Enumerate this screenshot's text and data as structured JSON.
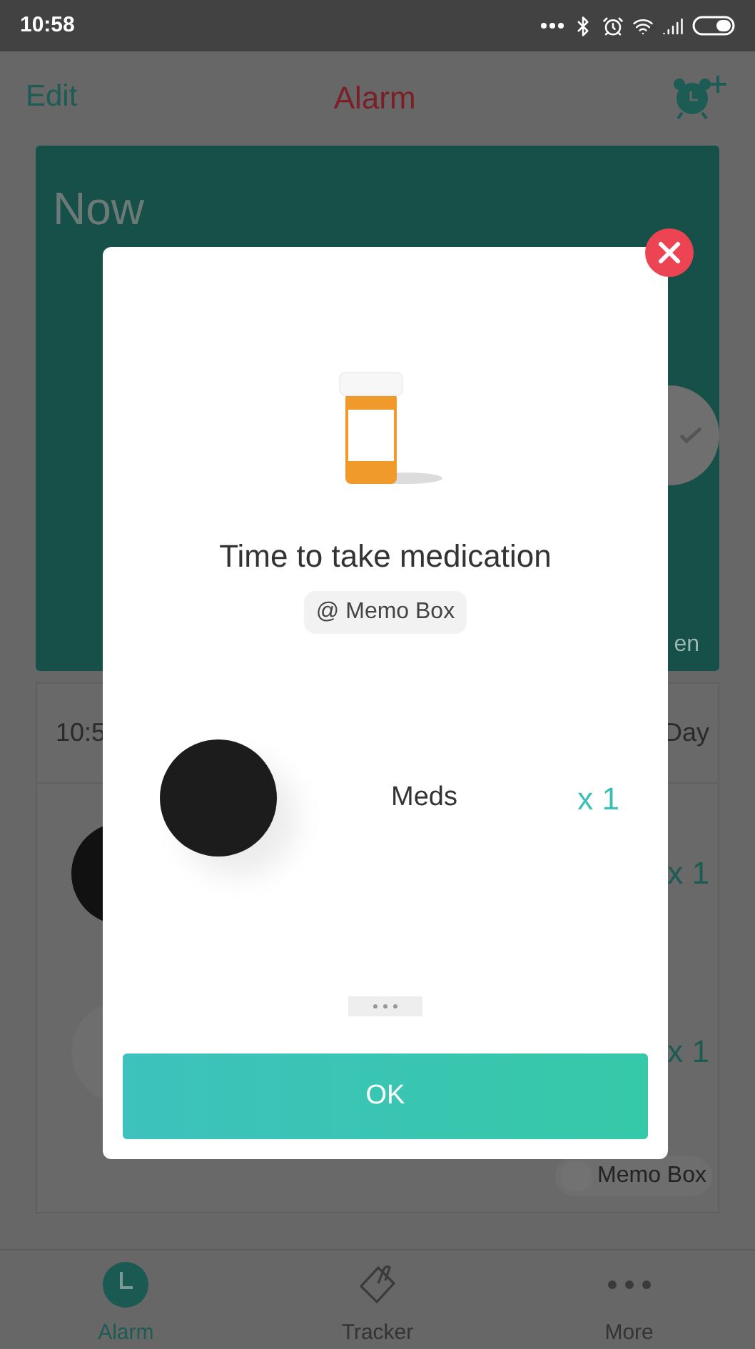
{
  "status_bar": {
    "time": "10:58"
  },
  "header": {
    "edit": "Edit",
    "title": "Alarm"
  },
  "now_card": {
    "title": "Now",
    "caption": "en"
  },
  "schedule_card": {
    "time": "10:5",
    "repeat": "Day",
    "doses": [
      "x 1",
      "x 1"
    ],
    "device": "Memo Box"
  },
  "dialog": {
    "title": "Time to take medication",
    "location": "@ Memo Box",
    "items": [
      {
        "name": "Meds",
        "quantity": "x 1"
      }
    ],
    "ok": "OK"
  },
  "tabs": [
    {
      "label": "Alarm",
      "kind": "clock",
      "selected": true
    },
    {
      "label": "Tracker",
      "kind": "clip",
      "selected": false
    },
    {
      "label": "More",
      "kind": "dots",
      "selected": false
    }
  ]
}
